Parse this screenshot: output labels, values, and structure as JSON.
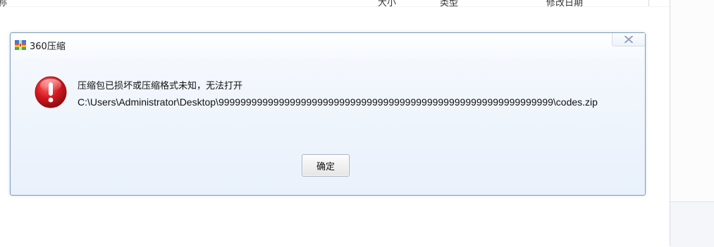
{
  "background": {
    "columns": {
      "name": "称",
      "size": "大小",
      "type": "类型",
      "date": "修改日期"
    }
  },
  "dialog": {
    "title": "360压缩",
    "message": "压缩包已损坏或压缩格式未知，无法打开",
    "path": "C:\\Users\\Administrator\\Desktop\\9999999999999999999999999999999999999999999999999999999999999\\codes.zip",
    "ok_label": "确定",
    "icons": {
      "app": "archive-app-icon",
      "error": "error-icon",
      "close": "close-icon"
    },
    "colors": {
      "error_red": "#d4191f",
      "border": "#7f9db9"
    }
  }
}
